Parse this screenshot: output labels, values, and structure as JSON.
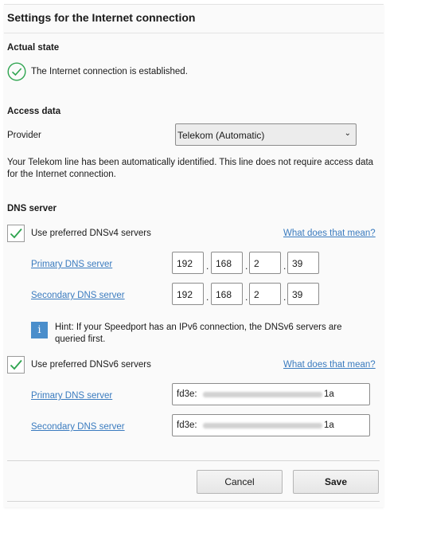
{
  "page": {
    "title": "Settings for the Internet connection"
  },
  "actual_state": {
    "heading": "Actual state",
    "status_text": "The Internet connection is established.",
    "status_icon": "check-circle-icon",
    "status_color": "#2ea44f"
  },
  "access_data": {
    "heading": "Access data",
    "provider_label": "Provider",
    "provider_value": "Telekom (Automatic)",
    "description": "Your Telekom line has been automatically identified. This line does not require access data for the Internet connection."
  },
  "dns": {
    "heading": "DNS server",
    "ipv4": {
      "checkbox_label": "Use preferred DNSv4 servers",
      "checked": true,
      "help_link": "What does that mean?",
      "primary_label": "Primary DNS server",
      "primary": [
        "192",
        "168",
        "2",
        "39"
      ],
      "secondary_label": "Secondary DNS server",
      "secondary": [
        "192",
        "168",
        "2",
        "39"
      ]
    },
    "hint": {
      "icon": "info-icon",
      "text": "Hint: If your Speedport has an IPv6 connection, the DNSv6 servers are queried first."
    },
    "ipv6": {
      "checkbox_label": "Use preferred DNSv6 servers",
      "checked": true,
      "help_link": "What does that mean?",
      "primary_label": "Primary DNS server",
      "primary_prefix": "fd3e:",
      "primary_suffix": "1a",
      "secondary_label": "Secondary DNS server",
      "secondary_prefix": "fd3e:",
      "secondary_suffix": "1a"
    }
  },
  "buttons": {
    "cancel": "Cancel",
    "save": "Save"
  },
  "colors": {
    "accent": "#3a7bbf",
    "check": "#2ea44f",
    "info": "#4a8ecb"
  }
}
